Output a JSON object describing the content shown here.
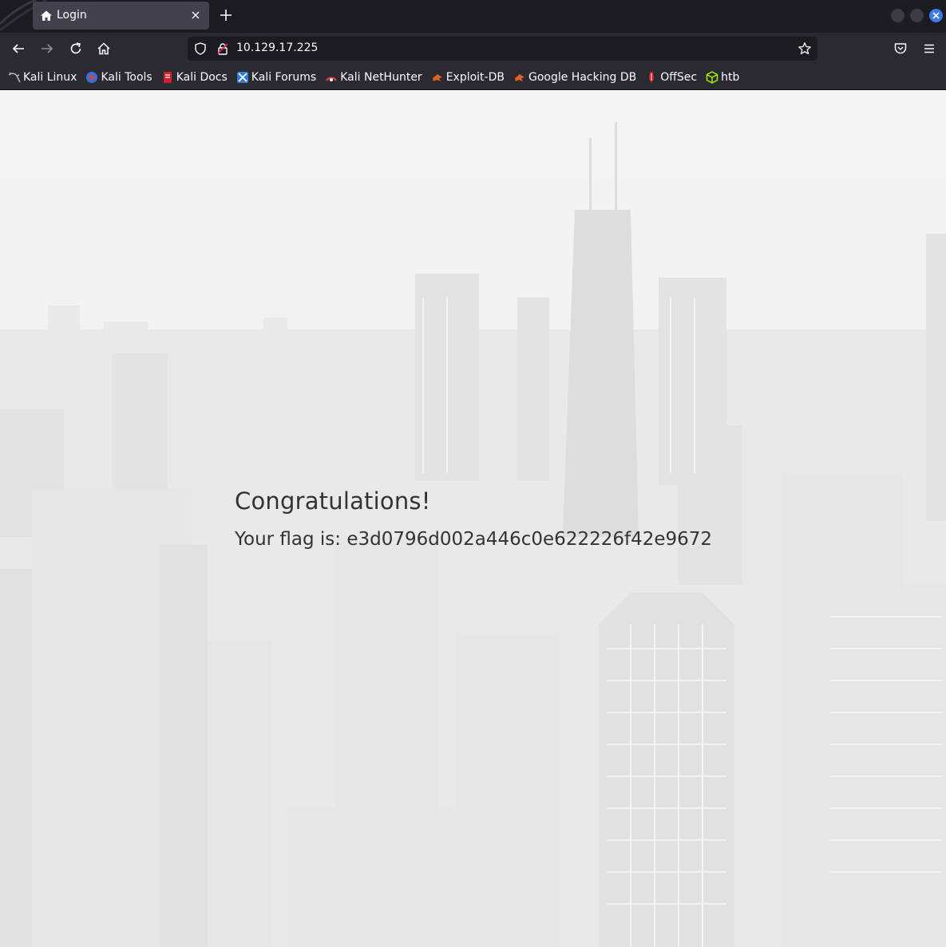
{
  "tab": {
    "title": "Login"
  },
  "address_bar": {
    "url": "10.129.17.225"
  },
  "bookmarks": [
    {
      "label": "Kali Linux",
      "icon": "kali-dragon-icon"
    },
    {
      "label": "Kali Tools",
      "icon": "kali-tools-icon"
    },
    {
      "label": "Kali Docs",
      "icon": "kali-docs-icon"
    },
    {
      "label": "Kali Forums",
      "icon": "kali-forums-icon"
    },
    {
      "label": "Kali NetHunter",
      "icon": "kali-nethunter-icon"
    },
    {
      "label": "Exploit-DB",
      "icon": "exploit-db-icon"
    },
    {
      "label": "Google Hacking DB",
      "icon": "ghdb-icon"
    },
    {
      "label": "OffSec",
      "icon": "offsec-icon"
    },
    {
      "label": "htb",
      "icon": "htb-cube-icon"
    }
  ],
  "page": {
    "heading": "Congratulations!",
    "flag_label": "Your flag is:",
    "flag_value": "e3d0796d002a446c0e622226f42e9672"
  },
  "colors": {
    "tab_active": "#42414d",
    "toolbar": "#2b2a33",
    "tabstrip": "#1c1b22",
    "close_button": "#3b7ae6",
    "page_background": "#f2f2f2",
    "text": "#333333"
  }
}
